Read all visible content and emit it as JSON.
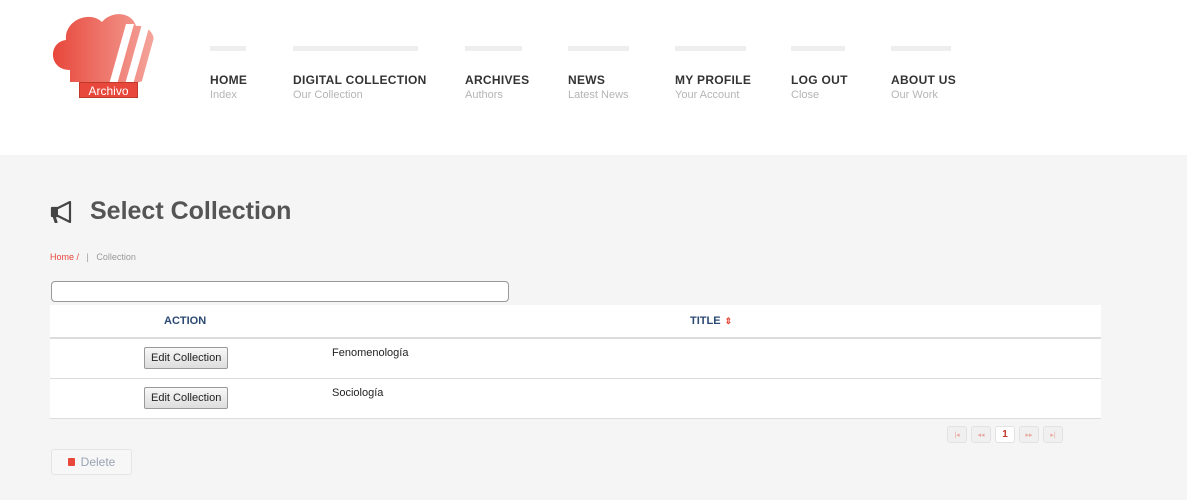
{
  "brand": {
    "logo_text": "Archivo"
  },
  "nav": [
    {
      "title": "HOME",
      "sub": "Index"
    },
    {
      "title": "DIGITAL COLLECTION",
      "sub": "Our Collection"
    },
    {
      "title": "ARCHIVES",
      "sub": "Authors"
    },
    {
      "title": "NEWS",
      "sub": "Latest News"
    },
    {
      "title": "MY PROFILE",
      "sub": "Your Account"
    },
    {
      "title": "LOG OUT",
      "sub": "Close"
    },
    {
      "title": "ABOUT US",
      "sub": "Our Work"
    }
  ],
  "page": {
    "title": "Select Collection",
    "icon": "megaphone-icon",
    "breadcrumb": {
      "home": "Home /",
      "separator": "|",
      "current": "Collection"
    }
  },
  "search": {
    "value": "",
    "placeholder": ""
  },
  "table": {
    "columns": {
      "action": "ACTION",
      "title": "TITLE",
      "sort_icon": "⇕"
    },
    "rows": [
      {
        "action": "Edit Collection",
        "title": "Fenomenología"
      },
      {
        "action": "Edit Collection",
        "title": "Sociología"
      }
    ]
  },
  "pagination": {
    "first": "|◂",
    "prev": "◂◂",
    "current": "1",
    "next": "▸▸",
    "last": "▸|"
  },
  "actions": {
    "delete_label": "Delete"
  },
  "colors": {
    "accent": "#e8473b",
    "header_text": "#2b4a73",
    "content_bg": "#f5f5f5"
  }
}
